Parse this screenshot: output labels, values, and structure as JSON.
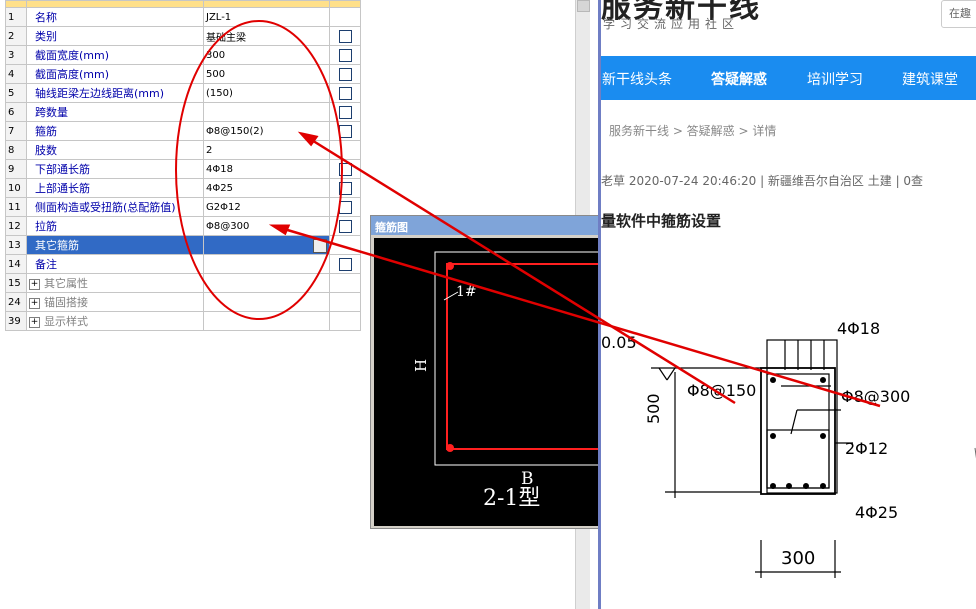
{
  "grid": {
    "rows": [
      {
        "num": "1",
        "name": "名称",
        "value": "JZL-1",
        "checkbox": false,
        "selected": false,
        "group": false
      },
      {
        "num": "2",
        "name": "类别",
        "value": "基础主梁",
        "checkbox": true,
        "selected": false,
        "group": false
      },
      {
        "num": "3",
        "name": "截面宽度(mm)",
        "value": "300",
        "checkbox": true,
        "selected": false,
        "group": false
      },
      {
        "num": "4",
        "name": "截面高度(mm)",
        "value": "500",
        "checkbox": true,
        "selected": false,
        "group": false
      },
      {
        "num": "5",
        "name": "轴线距梁左边线距离(mm)",
        "value": "(150)",
        "checkbox": true,
        "selected": false,
        "group": false
      },
      {
        "num": "6",
        "name": "跨数量",
        "value": "",
        "checkbox": true,
        "selected": false,
        "group": false
      },
      {
        "num": "7",
        "name": "箍筋",
        "value": "Φ8@150(2)",
        "checkbox": true,
        "selected": false,
        "group": false
      },
      {
        "num": "8",
        "name": "肢数",
        "value": "2",
        "checkbox": false,
        "selected": false,
        "group": false
      },
      {
        "num": "9",
        "name": "下部通长筋",
        "value": "4Φ18",
        "checkbox": true,
        "selected": false,
        "group": false
      },
      {
        "num": "10",
        "name": "上部通长筋",
        "value": "4Φ25",
        "checkbox": true,
        "selected": false,
        "group": false
      },
      {
        "num": "11",
        "name": "侧面构造或受扭筋(总配筋值)",
        "value": "G2Φ12",
        "checkbox": true,
        "selected": false,
        "group": false
      },
      {
        "num": "12",
        "name": "拉筋",
        "value": "Φ8@300",
        "checkbox": true,
        "selected": false,
        "group": false
      },
      {
        "num": "13",
        "name": "其它箍筋",
        "value": "",
        "checkbox": false,
        "selected": true,
        "group": false
      },
      {
        "num": "14",
        "name": "备注",
        "value": "",
        "checkbox": true,
        "selected": false,
        "group": false
      },
      {
        "num": "15",
        "name": "其它属性",
        "value": "",
        "checkbox": false,
        "selected": false,
        "group": true
      },
      {
        "num": "24",
        "name": "锚固搭接",
        "value": "",
        "checkbox": false,
        "selected": false,
        "group": true
      },
      {
        "num": "39",
        "name": "显示样式",
        "value": "",
        "checkbox": false,
        "selected": false,
        "group": true
      }
    ],
    "expand_symbol": "+"
  },
  "popup": {
    "title": "箍筋图",
    "leg_label": "1#",
    "h_label": "H",
    "b_label": "B",
    "type_label": "2-1型"
  },
  "web": {
    "brand": "服务新干线",
    "slogan": "学习交流应用社区",
    "search_placeholder": "在趣",
    "nav": [
      "新干线头条",
      "答疑解惑",
      "培训学习",
      "建筑课堂"
    ],
    "active_nav": "答疑解惑",
    "breadcrumb": "服务新干线 > 答疑解惑 > 详情",
    "meta": "老草   2020-07-24 20:46:20   |   新疆维吾尔自治区  土建   |   0查",
    "article_title": "量软件中箍筋设置"
  },
  "drawing": {
    "top_bars": "4Φ18",
    "stirrup": "Φ8@150",
    "tie": "Φ8@300",
    "side_bars": "2Φ12",
    "bottom_bars": "4Φ25",
    "height": "500",
    "width": "300",
    "offset": "0.05"
  },
  "colors": {
    "annotation": "#e00000",
    "nav_bg": "#1a8cf0",
    "selection": "#316ac5",
    "header_yellow": "#ffe08a"
  }
}
